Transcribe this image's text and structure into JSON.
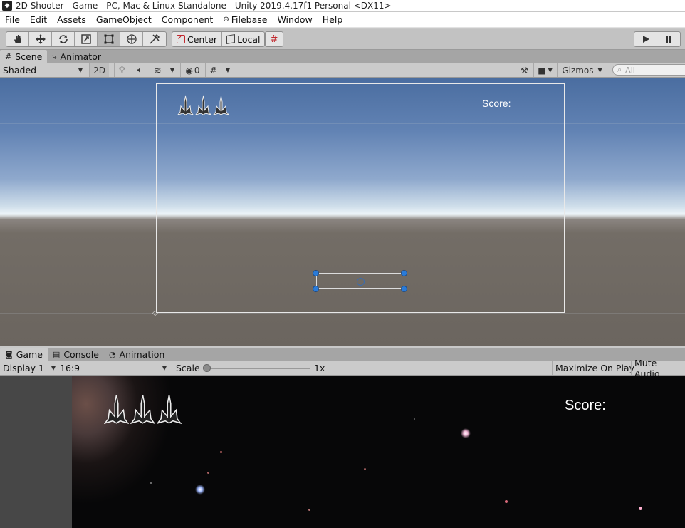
{
  "window": {
    "title": "2D Shooter - Game - PC, Mac & Linux Standalone - Unity 2019.4.17f1 Personal <DX11>"
  },
  "menu": {
    "items": [
      "File",
      "Edit",
      "Assets",
      "GameObject",
      "Component",
      "Filebase",
      "Window",
      "Help"
    ]
  },
  "toolbar": {
    "tools": [
      "hand-tool",
      "move-tool",
      "rotate-tool",
      "scale-tool",
      "rect-tool",
      "transform-tool",
      "custom-tool"
    ],
    "active_tool": "rect-tool",
    "pivot_label": "Center",
    "space_label": "Local",
    "play_icon": "play-icon",
    "pause_icon": "pause-icon"
  },
  "scene_tabs": {
    "scene_label": "Scene",
    "animator_label": "Animator"
  },
  "scene_toolbar": {
    "shading": "Shaded",
    "mode_2d": "2D",
    "hidden_count": "0",
    "gizmos_label": "Gizmos",
    "search_placeholder": "All"
  },
  "scene_view": {
    "score_label": "Score:"
  },
  "game_tabs": {
    "game_label": "Game",
    "console_label": "Console",
    "animation_label": "Animation"
  },
  "game_toolbar": {
    "display": "Display 1",
    "aspect": "16:9",
    "scale_label": "Scale",
    "scale_value": "1x",
    "scale_fraction": 0.0,
    "maximize_label": "Maximize On Play",
    "mute_label": "Mute Audio"
  },
  "game_view": {
    "score_label": "Score:"
  }
}
